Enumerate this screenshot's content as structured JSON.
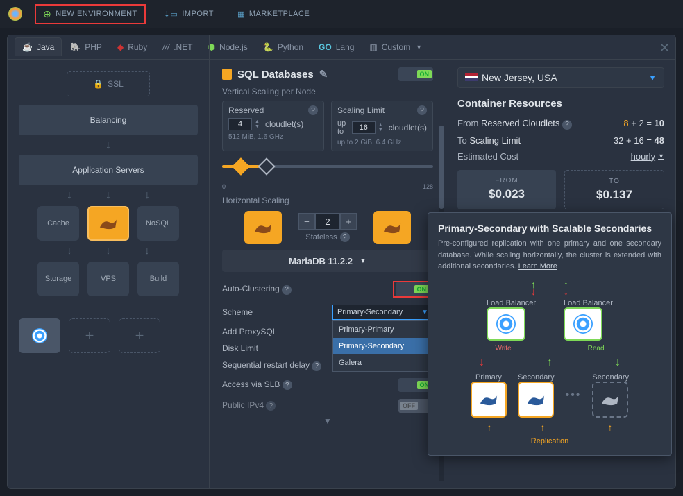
{
  "topbar": {
    "new_env": "NEW ENVIRONMENT",
    "import": "IMPORT",
    "marketplace": "MARKETPLACE"
  },
  "lang_tabs": [
    "Java",
    "PHP",
    "Ruby",
    ".NET",
    "Node.js",
    "Python",
    "Lang",
    "Custom"
  ],
  "ssl_label": "SSL",
  "layers": {
    "balancing": "Balancing",
    "app_servers": "Application Servers",
    "cache": "Cache",
    "nosql": "NoSQL",
    "storage": "Storage",
    "vps": "VPS",
    "build": "Build"
  },
  "sql": {
    "title": "SQL Databases",
    "toggle": "ON",
    "vertical_scaling": "Vertical Scaling per Node",
    "reserved": {
      "label": "Reserved",
      "value": "4",
      "unit": "cloudlet(s)",
      "info": "512 MiB, 1.6 GHz"
    },
    "limit": {
      "label": "Scaling Limit",
      "prefix": "up to",
      "value": "16",
      "unit": "cloudlet(s)",
      "info": "up to 2 GiB, 6.4 GHz"
    },
    "slider_min": "0",
    "slider_max": "128",
    "horizontal_scaling": "Horizontal Scaling",
    "node_count": "2",
    "stateless": "Stateless",
    "db_version": "MariaDB 11.2.2",
    "settings": {
      "auto_clustering": "Auto-Clustering",
      "scheme": "Scheme",
      "add_proxysql": "Add ProxySQL",
      "disk_limit": "Disk Limit",
      "seq_restart": "Sequential restart delay",
      "access_slb": "Access via SLB",
      "public_ipv4": "Public IPv4"
    },
    "scheme_value": "Primary-Secondary",
    "scheme_options": [
      "Primary-Primary",
      "Primary-Secondary",
      "Galera"
    ],
    "toggles": {
      "auto_clustering": "ON",
      "access_slb": "ON",
      "public_ipv4": "OFF"
    }
  },
  "region": "New Jersey, USA",
  "resources": {
    "title": "Container Resources",
    "from_label": "From",
    "from_text": "Reserved Cloudlets",
    "from_expr_a": "8",
    "from_expr_b": "2",
    "from_total": "10",
    "to_label": "To",
    "to_text": "Scaling Limit",
    "to_expr_a": "32",
    "to_expr_b": "16",
    "to_total": "48",
    "est_cost": "Estimated Cost",
    "period": "hourly",
    "cost_from_label": "FROM",
    "cost_from": "$0.023",
    "cost_to_label": "TO",
    "cost_to": "$0.137"
  },
  "popup": {
    "title": "Primary-Secondary with Scalable Secondaries",
    "desc": "Pre-configured replication with one primary and one secondary database. While scaling horizontally, the cluster is extended with additional secondaries. ",
    "learn_more": "Learn More",
    "load_balancer": "Load Balancer",
    "write": "Write",
    "read": "Read",
    "primary": "Primary",
    "secondary": "Secondary",
    "replication": "Replication"
  }
}
